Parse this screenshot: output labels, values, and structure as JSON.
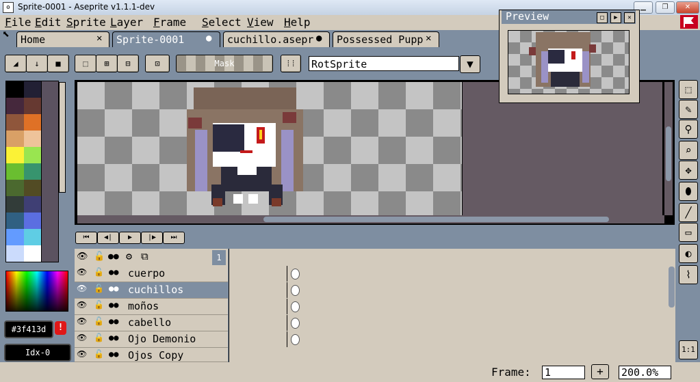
{
  "window": {
    "title": "Sprite-0001 - Aseprite v1.1.1-dev"
  },
  "menu": [
    {
      "first": "F",
      "rest": "ile"
    },
    {
      "first": "E",
      "rest": "dit"
    },
    {
      "first": "S",
      "rest": "prite"
    },
    {
      "first": "L",
      "rest": "ayer"
    },
    {
      "first": "F",
      "rest": "rame"
    },
    {
      "first": "S",
      "rest": "elect"
    },
    {
      "first": "V",
      "rest": "iew"
    },
    {
      "first": "H",
      "rest": "elp"
    }
  ],
  "tabs": [
    {
      "label": "Home",
      "close": "✕"
    },
    {
      "label": "Sprite-0001",
      "close": "●"
    },
    {
      "label": "cuchillo.aseprite",
      "close": "●"
    },
    {
      "label": "Possessed Puppet",
      "close": "✕"
    }
  ],
  "contextbar": {
    "mask_label": "Mask",
    "rotation_algorithm": "RotSprite"
  },
  "palette": {
    "colors": [
      "#000000",
      "#222034",
      "#45283c",
      "#663931",
      "#8f563b",
      "#df7126",
      "#d9a066",
      "#eec39a",
      "#fbf236",
      "#99e550",
      "#6abe30",
      "#37946e",
      "#4b692f",
      "#524b24",
      "#323c39",
      "#3f3f74",
      "#306082",
      "#5b6ee1",
      "#639bff",
      "#5fcde4",
      "#cbdbfc",
      "#ffffff"
    ]
  },
  "color_bar": {
    "hex_value": "#3f413d",
    "warning_icon": "!",
    "index_value": "Idx-0"
  },
  "preview": {
    "title": "Preview"
  },
  "timeline": {
    "frame_header": "1",
    "layers": [
      {
        "name": "cuerpo",
        "selected": false
      },
      {
        "name": "cuchillos",
        "selected": true
      },
      {
        "name": "moños",
        "selected": false
      },
      {
        "name": "cabello",
        "selected": false
      },
      {
        "name": "Ojo Demonio",
        "selected": false
      },
      {
        "name": "Ojos Copy",
        "selected": false
      }
    ]
  },
  "statusbar": {
    "frame_label": "Frame:",
    "frame_value": "1",
    "add_frame": "+",
    "zoom_value": "200.0%"
  },
  "toolbox": {
    "zoom_reset": "1:1"
  }
}
